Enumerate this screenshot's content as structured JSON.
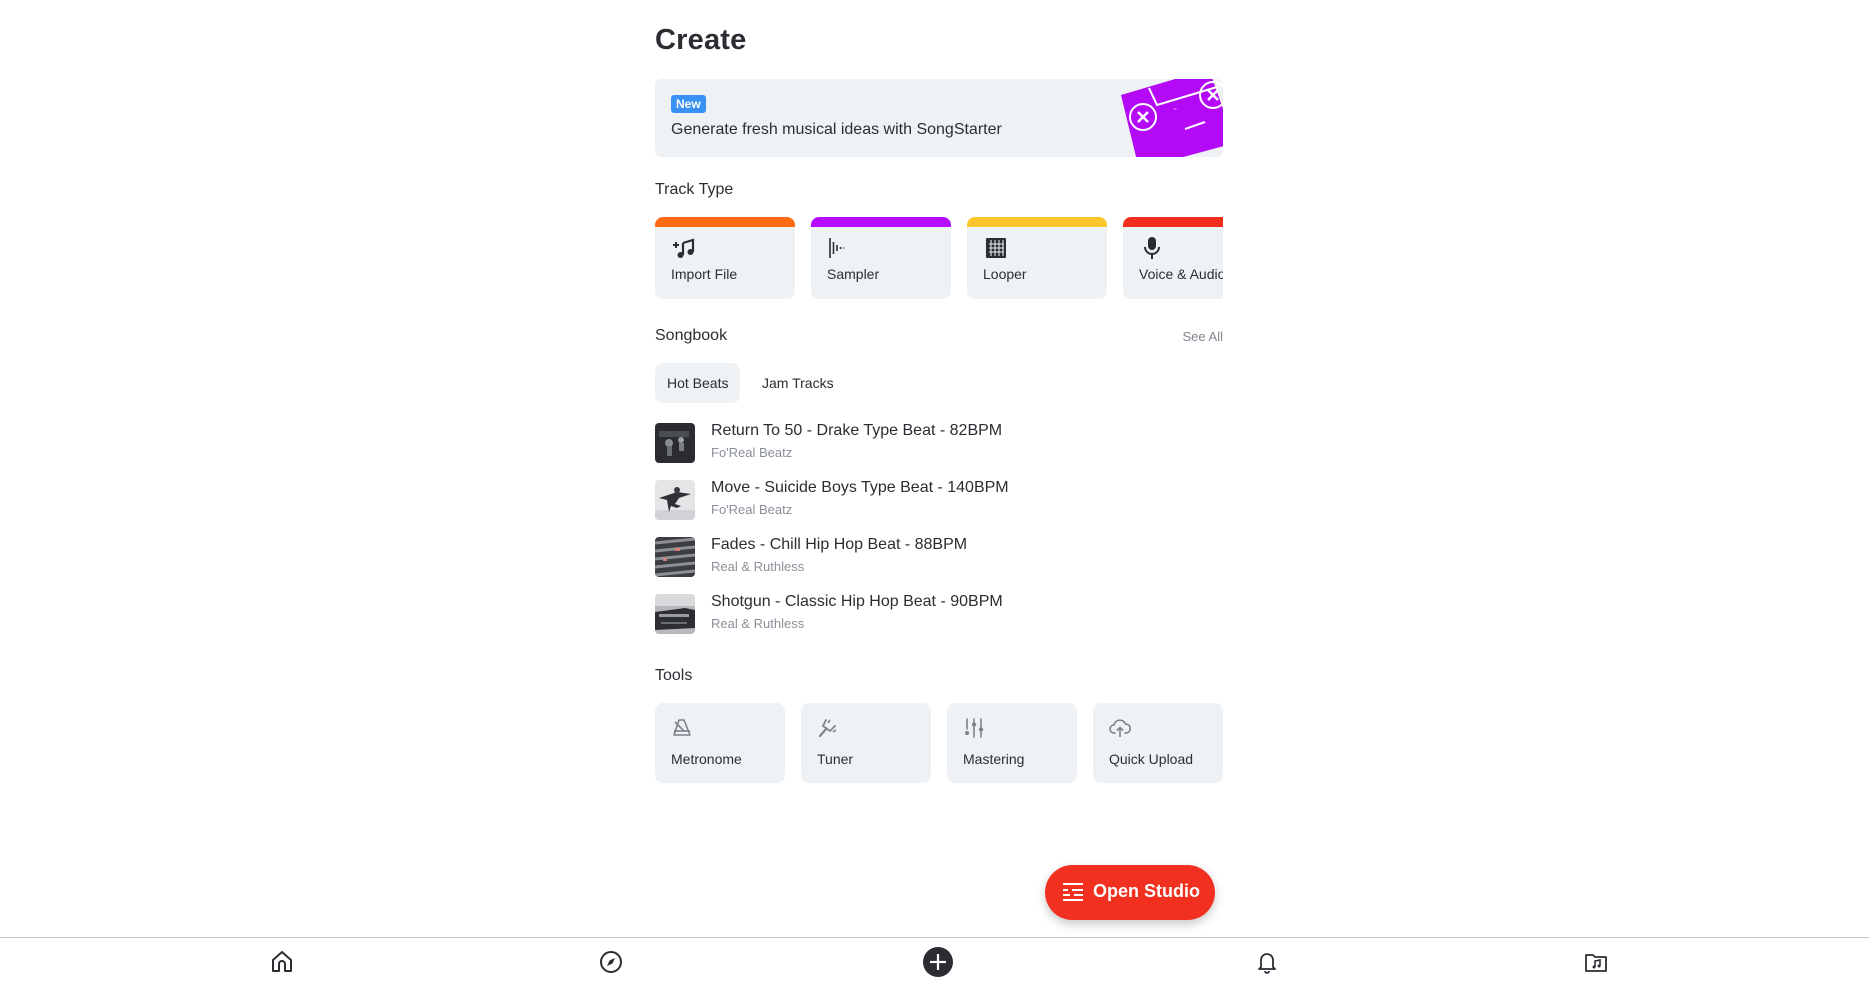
{
  "page": {
    "title": "Create"
  },
  "banner": {
    "badge": "New",
    "text": "Generate fresh musical ideas with SongStarter",
    "art_color": "#b309f6"
  },
  "track_type": {
    "label": "Track Type",
    "cards": [
      {
        "label": "Import File",
        "icon": "import-music-icon",
        "color": "#ff6a13"
      },
      {
        "label": "Sampler",
        "icon": "waveform-icon",
        "color": "#b50bff"
      },
      {
        "label": "Looper",
        "icon": "grid-icon",
        "color": "#fcc72c"
      },
      {
        "label": "Voice & Audio",
        "icon": "microphone-icon",
        "color": "#f22f1f"
      }
    ]
  },
  "songbook": {
    "label": "Songbook",
    "see_all": "See All",
    "tabs": [
      {
        "label": "Hot Beats",
        "active": true
      },
      {
        "label": "Jam Tracks",
        "active": false
      }
    ],
    "songs": [
      {
        "title": "Return To 50 - Drake Type Beat - 82BPM",
        "artist": "Fo'Real Beatz"
      },
      {
        "title": "Move - Suicide Boys Type Beat - 140BPM",
        "artist": "Fo'Real Beatz"
      },
      {
        "title": "Fades - Chill Hip Hop Beat - 88BPM",
        "artist": "Real & Ruthless"
      },
      {
        "title": "Shotgun - Classic Hip Hop Beat - 90BPM",
        "artist": "Real & Ruthless"
      }
    ]
  },
  "tools": {
    "label": "Tools",
    "items": [
      {
        "label": "Metronome",
        "icon": "metronome-icon"
      },
      {
        "label": "Tuner",
        "icon": "tuning-fork-icon"
      },
      {
        "label": "Mastering",
        "icon": "sliders-icon"
      },
      {
        "label": "Quick Upload",
        "icon": "cloud-upload-icon"
      }
    ]
  },
  "open_studio": {
    "label": "Open Studio",
    "icon": "tracks-list-icon",
    "color": "#f2301f"
  },
  "bottom_nav": [
    {
      "name": "home",
      "icon": "home-icon"
    },
    {
      "name": "explore",
      "icon": "compass-icon"
    },
    {
      "name": "create",
      "icon": "plus-circle-icon",
      "active": true
    },
    {
      "name": "notifications",
      "icon": "bell-icon"
    },
    {
      "name": "library",
      "icon": "music-folder-icon"
    }
  ]
}
